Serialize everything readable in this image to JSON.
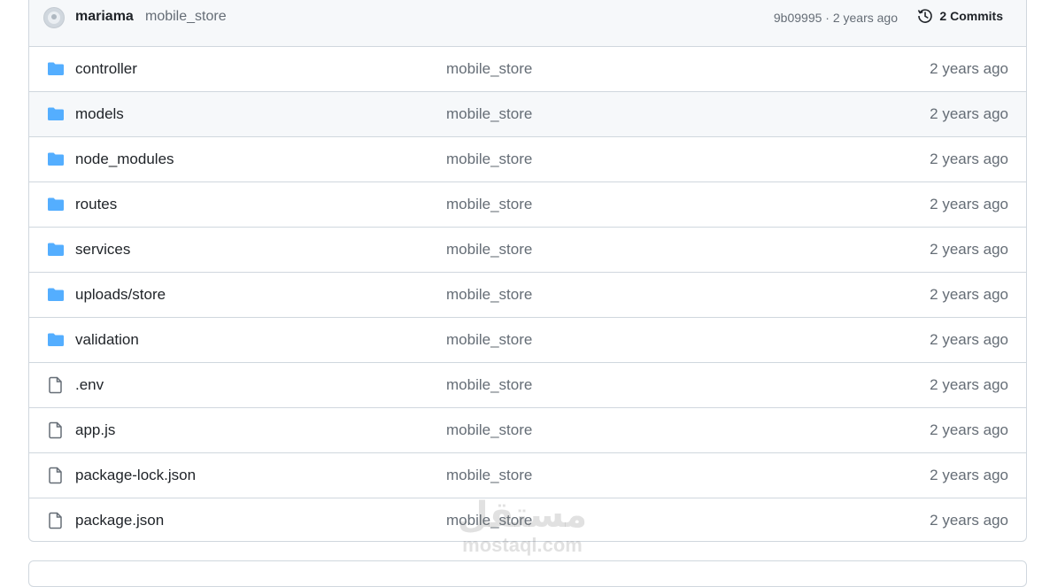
{
  "header": {
    "author": "mariama",
    "commit_message": "mobile_store",
    "commit_meta": "9b09995 · 2 years ago",
    "commits_label": "2 Commits"
  },
  "files": [
    {
      "name": "controller",
      "type": "folder",
      "message": "mobile_store",
      "age": "2 years ago"
    },
    {
      "name": "models",
      "type": "folder",
      "message": "mobile_store",
      "age": "2 years ago"
    },
    {
      "name": "node_modules",
      "type": "folder",
      "message": "mobile_store",
      "age": "2 years ago"
    },
    {
      "name": "routes",
      "type": "folder",
      "message": "mobile_store",
      "age": "2 years ago"
    },
    {
      "name": "services",
      "type": "folder",
      "message": "mobile_store",
      "age": "2 years ago"
    },
    {
      "name": "uploads/store",
      "type": "folder",
      "message": "mobile_store",
      "age": "2 years ago"
    },
    {
      "name": "validation",
      "type": "folder",
      "message": "mobile_store",
      "age": "2 years ago"
    },
    {
      "name": ".env",
      "type": "file",
      "message": "mobile_store",
      "age": "2 years ago"
    },
    {
      "name": "app.js",
      "type": "file",
      "message": "mobile_store",
      "age": "2 years ago"
    },
    {
      "name": "package-lock.json",
      "type": "file",
      "message": "mobile_store",
      "age": "2 years ago"
    },
    {
      "name": "package.json",
      "type": "file",
      "message": "mobile_store",
      "age": "2 years ago"
    }
  ],
  "watermark": {
    "arabic": "مستقل",
    "latin": "mostaql.com"
  },
  "colors": {
    "folder_icon": "#54aeff",
    "muted_text": "#656d76",
    "border": "#d0d7de",
    "header_bg": "#f6f8fa"
  }
}
